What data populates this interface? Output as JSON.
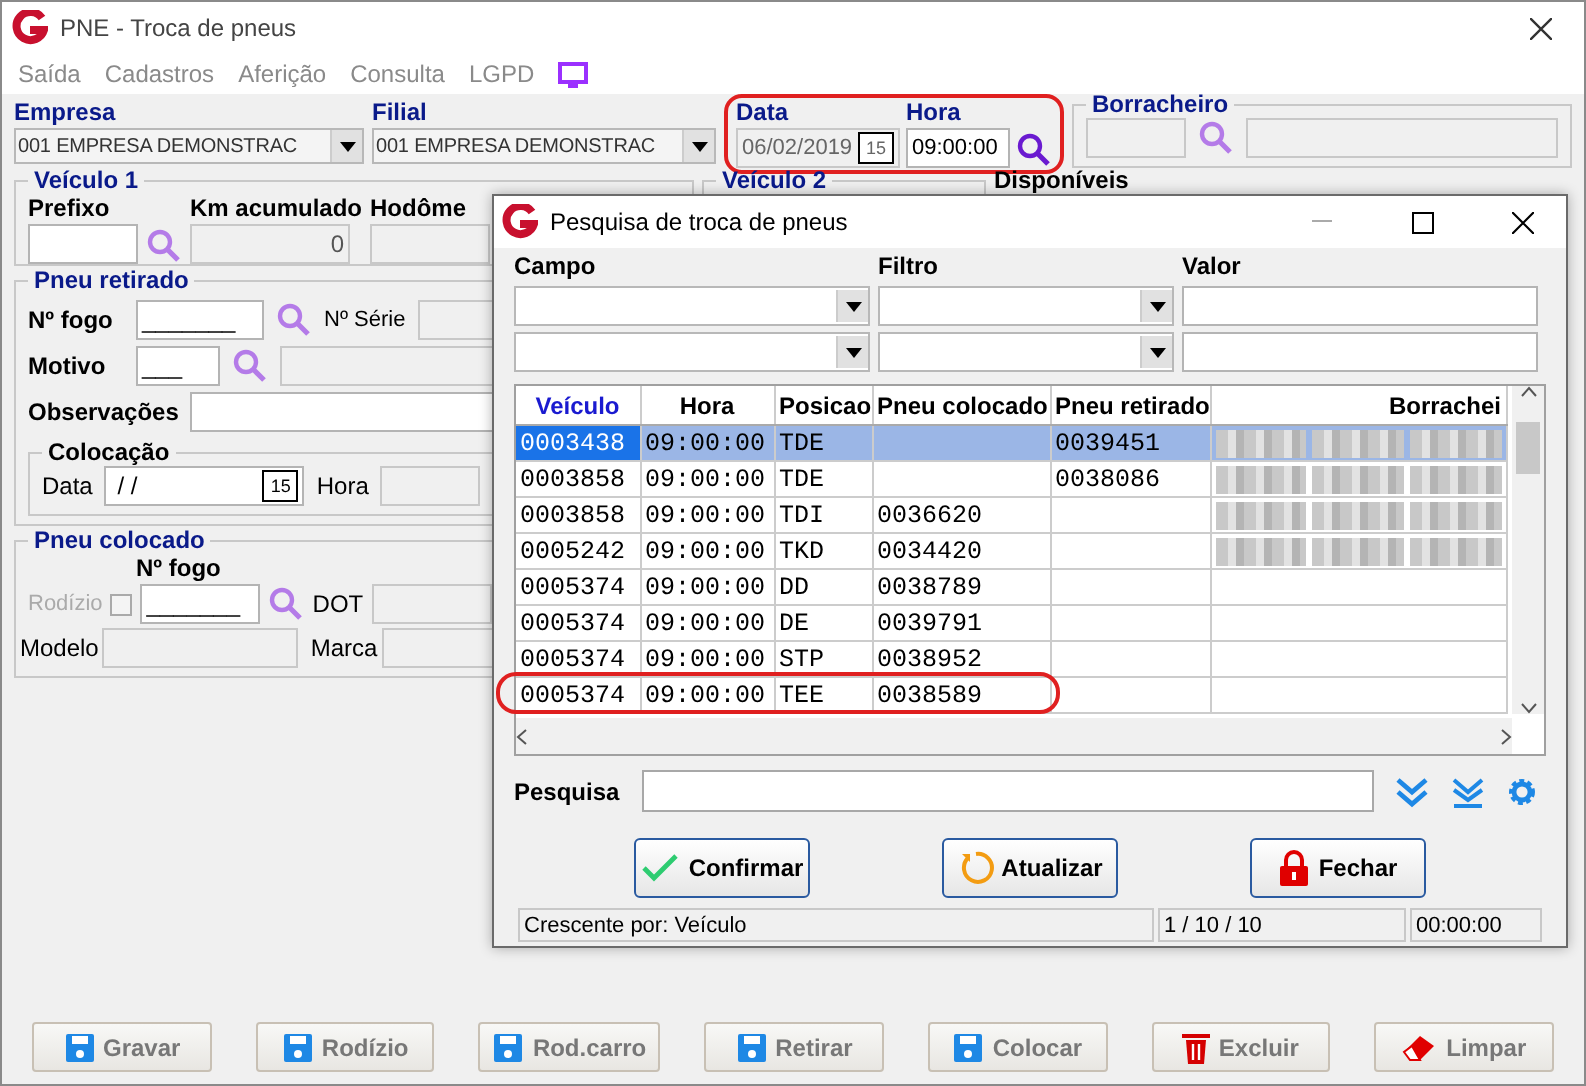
{
  "window": {
    "title": "PNE - Troca de pneus"
  },
  "menu": [
    {
      "label": "Saída"
    },
    {
      "label": "Cadastros"
    },
    {
      "label": "Aferição"
    },
    {
      "label": "Consulta"
    },
    {
      "label": "LGPD"
    }
  ],
  "header": {
    "empresa": {
      "label": "Empresa",
      "value": "001 EMPRESA DEMONSTRAC"
    },
    "filial": {
      "label": "Filial",
      "value": "001 EMPRESA DEMONSTRAC"
    },
    "data": {
      "label": "Data",
      "value": "06/02/2019",
      "calendar_day": "15"
    },
    "hora": {
      "label": "Hora",
      "value": "09:00:00"
    },
    "date_time_highlighted": true,
    "borracheiro": {
      "label": "Borracheiro"
    }
  },
  "veiculo1": {
    "title": "Veículo 1",
    "prefixo_label": "Prefixo",
    "km_label": "Km acumulado",
    "km_value": "0",
    "hodometro_label": "Hodôme"
  },
  "veiculo2": {
    "title": "Veículo 2"
  },
  "disponiveis": {
    "title": "Disponíveis"
  },
  "pneu_retirado": {
    "title": "Pneu retirado",
    "fogo_label": "Nº fogo",
    "fogo_mask": "_______",
    "serie_label": "Nº Série",
    "motivo_label": "Motivo",
    "motivo_mask": "___",
    "observacoes_label": "Observações",
    "colocacao": {
      "title": "Colocação",
      "data_label": "Data",
      "data_value": " / /",
      "calendar_day": "15",
      "hora_label": "Hora"
    }
  },
  "pneu_colocado": {
    "title": "Pneu colocado",
    "fogo_label": "Nº fogo",
    "fogo_mask": "_______",
    "rodizio": {
      "label": "Rodízio",
      "checked": false,
      "disabled": true
    },
    "dot_label": "DOT",
    "modelo_label": "Modelo",
    "marca_label": "Marca"
  },
  "buttons": [
    {
      "label": "Gravar",
      "kind": "disk",
      "disabled": true
    },
    {
      "label": "Rodízio",
      "kind": "disk",
      "disabled": true
    },
    {
      "label": "Rod.carro",
      "kind": "disk",
      "disabled": true
    },
    {
      "label": "Retirar",
      "kind": "disk",
      "disabled": true
    },
    {
      "label": "Colocar",
      "kind": "disk",
      "disabled": true
    },
    {
      "label": "Excluir",
      "kind": "trash",
      "disabled": true
    },
    {
      "label": "Limpar",
      "kind": "eraser",
      "disabled": true
    }
  ],
  "dialog": {
    "title": "Pesquisa de troca de pneus",
    "filter_labels": [
      "Campo",
      "Filtro",
      "Valor"
    ],
    "columns": [
      {
        "label": "Veículo",
        "sorted": true
      },
      {
        "label": "Hora",
        "sorted": false
      },
      {
        "label": "Posicao",
        "sorted": false
      },
      {
        "label": "Pneu colocado",
        "sorted": false
      },
      {
        "label": "Pneu retirado",
        "sorted": false
      },
      {
        "label": "Borrachei",
        "sorted": false
      }
    ],
    "rows": [
      {
        "cells": [
          "0003438",
          "09:00:00",
          "TDE",
          "",
          "0039451"
        ],
        "blurred": true,
        "selected": true,
        "highlighted": false
      },
      {
        "cells": [
          "0003858",
          "09:00:00",
          "TDE",
          "",
          "0038086"
        ],
        "blurred": true,
        "selected": false,
        "highlighted": false
      },
      {
        "cells": [
          "0003858",
          "09:00:00",
          "TDI",
          "0036620",
          ""
        ],
        "blurred": true,
        "selected": false,
        "highlighted": false
      },
      {
        "cells": [
          "0005242",
          "09:00:00",
          "TKD",
          "0034420",
          ""
        ],
        "blurred": true,
        "selected": false,
        "highlighted": false
      },
      {
        "cells": [
          "0005374",
          "09:00:00",
          "DD",
          "0038789",
          ""
        ],
        "blurred": false,
        "selected": false,
        "highlighted": false
      },
      {
        "cells": [
          "0005374",
          "09:00:00",
          "DE",
          "0039791",
          ""
        ],
        "blurred": false,
        "selected": false,
        "highlighted": false
      },
      {
        "cells": [
          "0005374",
          "09:00:00",
          "STP",
          "0038952",
          ""
        ],
        "blurred": false,
        "selected": false,
        "highlighted": false
      },
      {
        "cells": [
          "0005374",
          "09:00:00",
          "TEE",
          "0038589",
          ""
        ],
        "blurred": false,
        "selected": false,
        "highlighted": true
      }
    ],
    "search_label": "Pesquisa",
    "buttons": [
      {
        "label": "Confirmar",
        "kind": "check"
      },
      {
        "label": "Atualizar",
        "kind": "refresh"
      },
      {
        "label": "Fechar",
        "kind": "lock"
      }
    ],
    "status": [
      "Crescente por: Veículo",
      "1 / 10 / 10",
      "00:00:00"
    ]
  }
}
